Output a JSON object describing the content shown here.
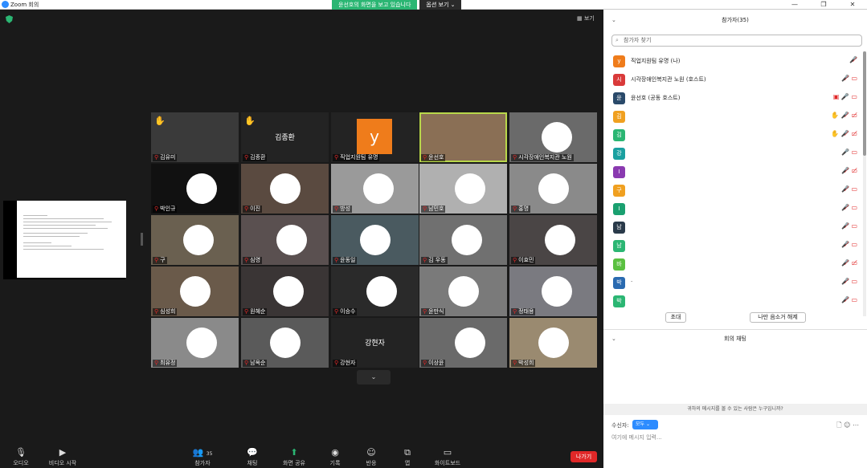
{
  "window": {
    "title": "Zoom 회의",
    "min": "—",
    "max": "❐",
    "close": "✕"
  },
  "share_banner": {
    "message": "윤선호의 화면을 보고 있습니다",
    "options": "옵션 보기 ⌄"
  },
  "view_button": "▦ 보기",
  "tiles": [
    {
      "name": "김유미",
      "hand": true,
      "bg": "#3a3a3a",
      "center": ""
    },
    {
      "name": "김종환",
      "hand": true,
      "bg": "#232323",
      "center": "김종환"
    },
    {
      "name": "직업지원팀 유명",
      "hand": false,
      "bg": "#232323",
      "center": "",
      "avatar": "y"
    },
    {
      "name": "윤선호",
      "hand": false,
      "bg": "#8a6f55",
      "center": "",
      "active": true
    },
    {
      "name": "시각장애인복지관 노원",
      "hand": false,
      "bg": "#6a6a6a",
      "center": ""
    },
    {
      "name": "박인규",
      "hand": false,
      "bg": "#111111",
      "center": ""
    },
    {
      "name": "이진",
      "hand": false,
      "bg": "#5a4a40",
      "center": ""
    },
    {
      "name": "방성",
      "hand": false,
      "bg": "#9a9a9a",
      "center": ""
    },
    {
      "name": "남민호",
      "hand": false,
      "bg": "#b0b0b0",
      "center": ""
    },
    {
      "name": "홍명",
      "hand": false,
      "bg": "#8a8a8a",
      "center": ""
    },
    {
      "name": "구",
      "hand": false,
      "bg": "#6a6050",
      "center": ""
    },
    {
      "name": "심영",
      "hand": false,
      "bg": "#5a5050",
      "center": ""
    },
    {
      "name": "윤동일",
      "hand": false,
      "bg": "#4a5a60",
      "center": ""
    },
    {
      "name": "김 우동",
      "hand": false,
      "bg": "#707070",
      "center": ""
    },
    {
      "name": "이효민",
      "hand": false,
      "bg": "#4a4545",
      "center": ""
    },
    {
      "name": "심성희",
      "hand": false,
      "bg": "#6a5a4a",
      "center": ""
    },
    {
      "name": "원혜순",
      "hand": false,
      "bg": "#3a3535",
      "center": ""
    },
    {
      "name": "이승수",
      "hand": false,
      "bg": "#2a2a2a",
      "center": ""
    },
    {
      "name": "윤만식",
      "hand": false,
      "bg": "#7a7a7a",
      "center": ""
    },
    {
      "name": "정태용",
      "hand": false,
      "bg": "#7a7a80",
      "center": ""
    },
    {
      "name": "최유정",
      "hand": false,
      "bg": "#8a8a8a",
      "center": ""
    },
    {
      "name": "남옥순",
      "hand": false,
      "bg": "#5a5a5a",
      "center": ""
    },
    {
      "name": "강현자",
      "hand": false,
      "bg": "#232323",
      "center": "강현자"
    },
    {
      "name": "이상윤",
      "hand": false,
      "bg": "#6a6a6a",
      "center": ""
    },
    {
      "name": "박성희",
      "hand": false,
      "bg": "#9a8a70",
      "center": ""
    }
  ],
  "toolbar": {
    "audio": "오디오",
    "video": "비디오 시작",
    "participants": "참가자",
    "participants_count": "35",
    "chat": "채팅",
    "share": "화면 공유",
    "record": "기록",
    "reactions": "반응",
    "apps": "앱",
    "whiteboard": "화이트보드",
    "leave": "나가기",
    "pagedown": "⌄"
  },
  "panel": {
    "title": "참가자(35)",
    "search_placeholder": "참가자 찾기",
    "invite": "초대",
    "unmute_self": "나만 음소거 해제",
    "chat_title": "회의 채팅",
    "chat_note": "귀하의 메시지를 볼 수 있는 사람은 누구입니까?",
    "to_label": "수신자:",
    "to_value": "모두 ⌄",
    "input_placeholder": "여기에 메시지 입력..."
  },
  "participants": [
    {
      "initial": "y",
      "name": "직업지원팀 유명 (나)",
      "color": "#ef7c1b",
      "ctl": "🎤̸"
    },
    {
      "initial": "시",
      "name": "시각장애인복지관 노원 (호스트)",
      "color": "#d93a3a",
      "ctl": "🎤̸ ▭"
    },
    {
      "initial": "윤",
      "name": "윤선호 (공동 호스트)",
      "color": "#2a4a6a",
      "ctl": "▣ 🎤 ▭"
    },
    {
      "initial": "김",
      "name": "",
      "color": "#f0a020",
      "ctl": "✋ 🎤̸ ▭̸"
    },
    {
      "initial": "김",
      "name": "",
      "color": "#2bb673",
      "ctl": "✋ 🎤̸ ▭̸"
    },
    {
      "initial": "강",
      "name": "",
      "color": "#1aa0a0",
      "ctl": "🎤 ▭"
    },
    {
      "initial": "I",
      "name": "",
      "color": "#8a3ab0",
      "ctl": "🎤̸ ▭̸"
    },
    {
      "initial": "구",
      "name": "",
      "color": "#f0a020",
      "ctl": "🎤̸ ▭"
    },
    {
      "initial": "I",
      "name": "",
      "color": "#1aa070",
      "ctl": "🎤̸ ▭"
    },
    {
      "initial": "남",
      "name": "",
      "color": "#2a3a4a",
      "ctl": "🎤̸ ▭"
    },
    {
      "initial": "남",
      "name": "",
      "color": "#2bb673",
      "ctl": "🎤̸ ▭"
    },
    {
      "initial": "바",
      "name": "",
      "color": "#5ac040",
      "ctl": "🎤̸ ▭̸"
    },
    {
      "initial": "박",
      "name": "·",
      "color": "#2a6ab0",
      "ctl": "🎤̸ ▭"
    },
    {
      "initial": "박",
      "name": "",
      "color": "#2bb673",
      "ctl": "🎤̸ ▭"
    }
  ]
}
